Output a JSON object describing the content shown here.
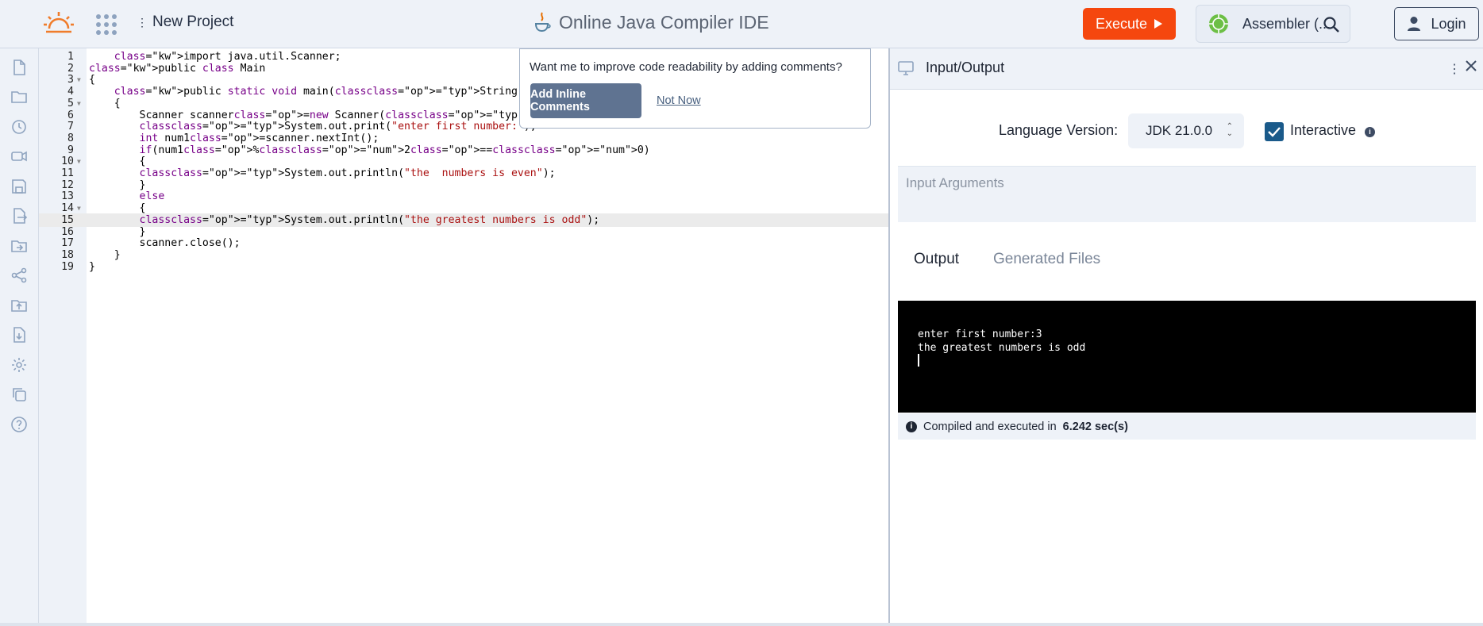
{
  "header": {
    "new_project_label": "New Project",
    "title": "Online Java Compiler IDE",
    "execute_label": "Execute",
    "language_label": "Assembler (...",
    "login_label": "Login"
  },
  "sidebar_icons": [
    "file-icon",
    "folder-icon",
    "history-icon",
    "video-icon",
    "save-icon",
    "file-export-icon",
    "folder-move-icon",
    "share-icon",
    "folder-upload-icon",
    "download-icon",
    "settings-icon",
    "copy-icon",
    "help-icon"
  ],
  "editor": {
    "active_line": 15,
    "lines": [
      {
        "n": "1",
        "text": "    import java.util.Scanner;"
      },
      {
        "n": "2",
        "text": "public class Main"
      },
      {
        "n": "3",
        "text": "{"
      },
      {
        "n": "4",
        "text": "    public static void main(String[]args)"
      },
      {
        "n": "5",
        "text": "    {"
      },
      {
        "n": "6",
        "text": "        Scanner scanner=new Scanner(System.in);"
      },
      {
        "n": "7",
        "text": "        System.out.print(\"enter first number:\");"
      },
      {
        "n": "8",
        "text": "        int num1=scanner.nextInt();"
      },
      {
        "n": "9",
        "text": "        if(num1%2==0)"
      },
      {
        "n": "10",
        "text": "        {"
      },
      {
        "n": "11",
        "text": "        System.out.println(\"the  numbers is even\");"
      },
      {
        "n": "12",
        "text": "        }"
      },
      {
        "n": "13",
        "text": "        else"
      },
      {
        "n": "14",
        "text": "        {"
      },
      {
        "n": "15",
        "text": "        System.out.println(\"the greatest numbers is odd\");"
      },
      {
        "n": "16",
        "text": "        }"
      },
      {
        "n": "17",
        "text": "        scanner.close();"
      },
      {
        "n": "18",
        "text": "    }"
      },
      {
        "n": "19",
        "text": "}"
      }
    ]
  },
  "popup": {
    "question": "Want me to improve code readability by adding comments?",
    "add_label": "Add Inline Comments",
    "not_now_label": "Not Now"
  },
  "io": {
    "title": "Input/Output",
    "language_version_label": "Language Version:",
    "language_version_value": "JDK 21.0.0",
    "interactive_label": "Interactive",
    "interactive_checked": true,
    "input_placeholder": "Input Arguments",
    "tab_output": "Output",
    "tab_generated": "Generated Files",
    "output_lines": [
      "enter first number:3",
      "the greatest numbers is odd"
    ],
    "status_prefix": "Compiled and executed in",
    "status_time": "6.242 sec(s)"
  },
  "colors": {
    "accent": "#f5470e",
    "brand": "#f07c2b",
    "checkbox": "#1a5a8a",
    "popup_button": "#5f7391"
  }
}
